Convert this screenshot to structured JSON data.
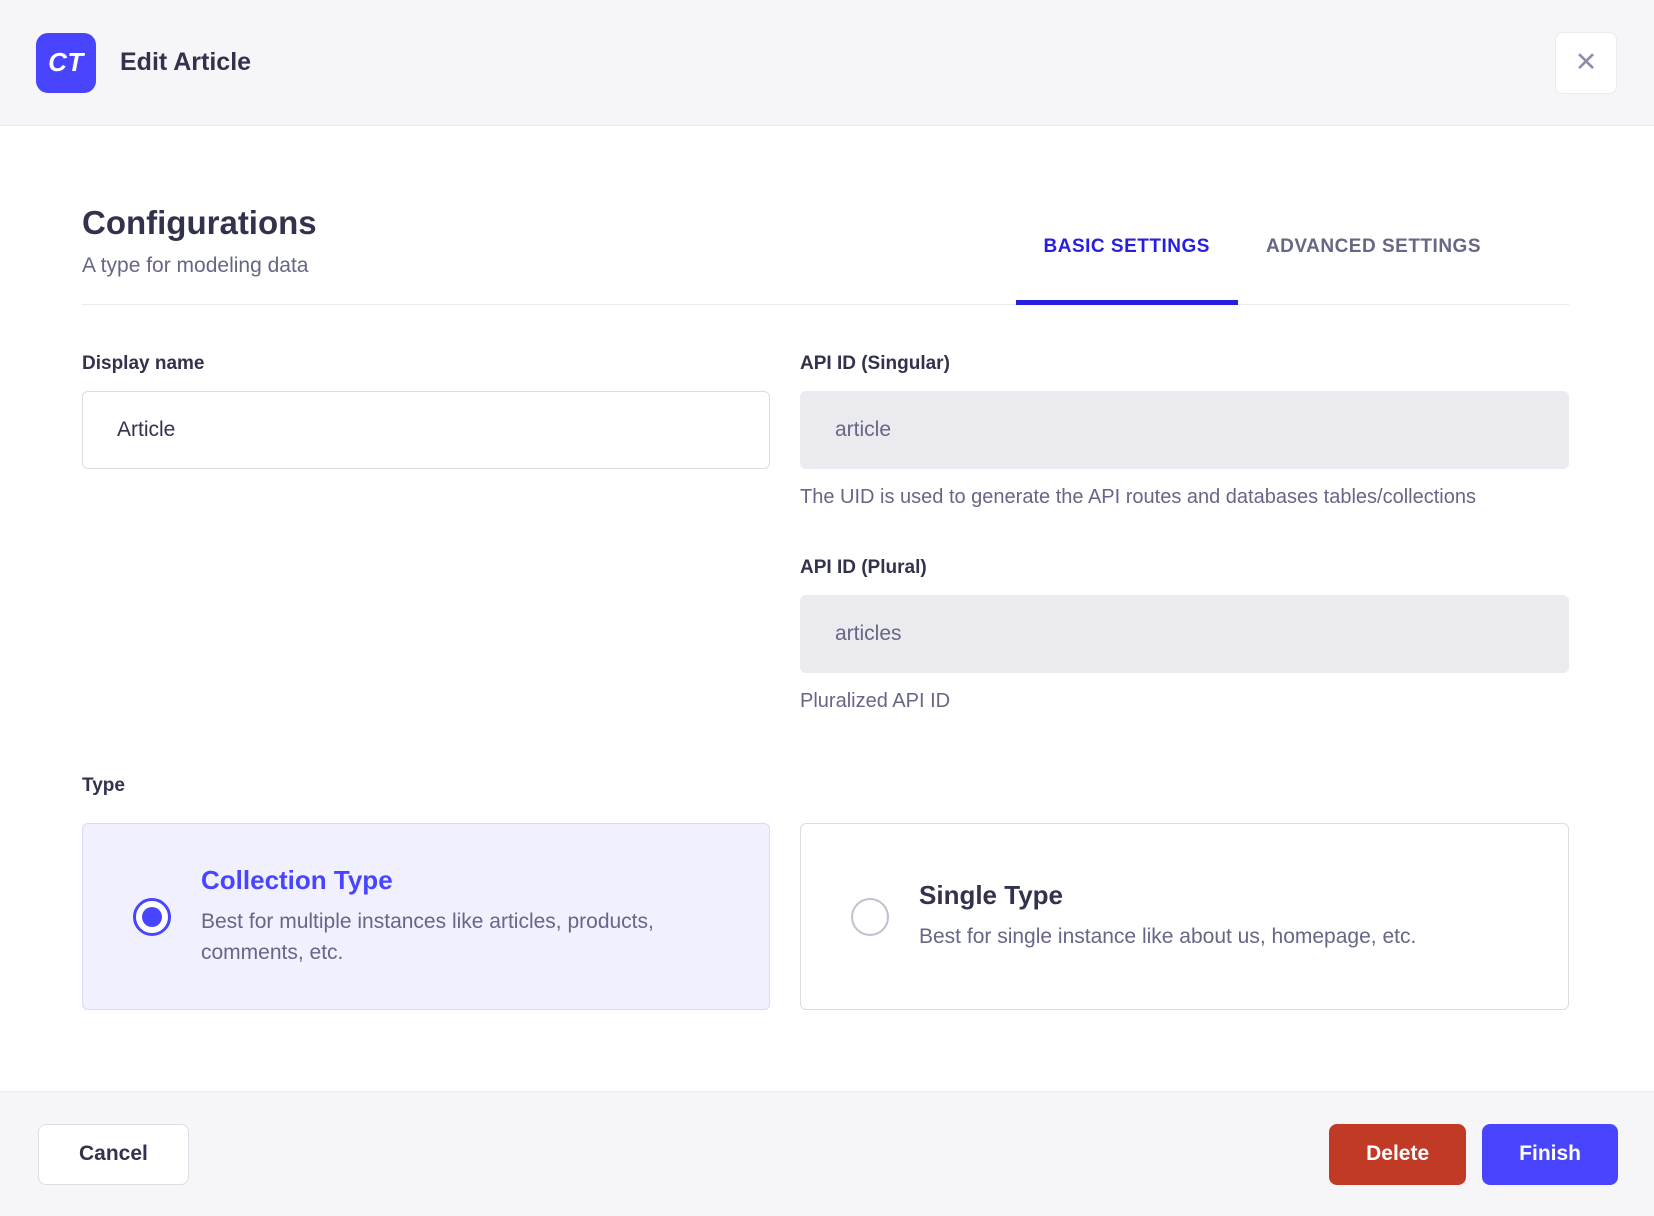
{
  "header": {
    "badge": "CT",
    "title": "Edit Article",
    "close_icon": "✕"
  },
  "section": {
    "title": "Configurations",
    "subtitle": "A type for modeling data",
    "tabs": [
      {
        "label": "BASIC SETTINGS",
        "active": true
      },
      {
        "label": "ADVANCED SETTINGS",
        "active": false
      }
    ]
  },
  "form": {
    "display_name": {
      "label": "Display name",
      "value": "Article"
    },
    "api_id_singular": {
      "label": "API ID (Singular)",
      "value": "article",
      "helper": "The UID is used to generate the API routes and databases tables/collections"
    },
    "api_id_plural": {
      "label": "API ID (Plural)",
      "value": "articles",
      "helper": "Pluralized API ID"
    },
    "type": {
      "label": "Type",
      "options": [
        {
          "title": "Collection Type",
          "description": "Best for multiple instances like articles, products, comments, etc.",
          "selected": true
        },
        {
          "title": "Single Type",
          "description": "Best for single instance like about us, homepage, etc.",
          "selected": false
        }
      ]
    }
  },
  "footer": {
    "cancel": "Cancel",
    "delete": "Delete",
    "finish": "Finish"
  },
  "colors": {
    "primary": "#4945ff",
    "tab_active": "#271fe0",
    "danger": "#c13a26",
    "header_bg": "#f6f6f9",
    "dark_text": "#32324d",
    "muted_text": "#666687"
  }
}
